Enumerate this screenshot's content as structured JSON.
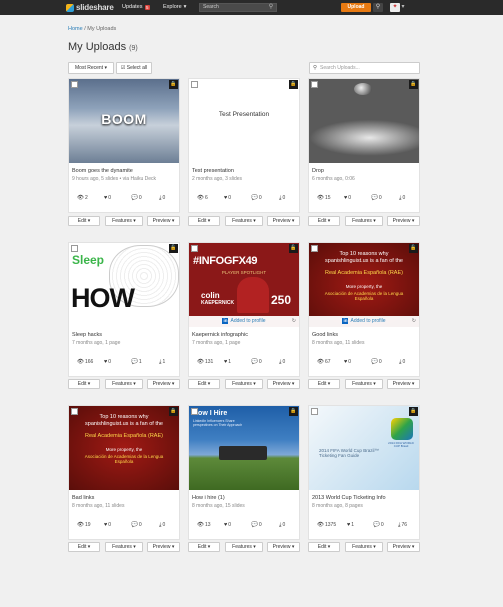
{
  "topbar": {
    "logo_text": "slideshare",
    "nav_updates": "Updates",
    "updates_count": "5",
    "nav_explore": "Explore",
    "search_placeholder": "Search",
    "upload_label": "Upload"
  },
  "breadcrumb": {
    "home": "Home",
    "sep": "/",
    "current": "My Uploads"
  },
  "page": {
    "title": "My Uploads",
    "count": "(9)"
  },
  "toolbar": {
    "sort_label": "Most Recent",
    "select_all": "Select all",
    "search_placeholder": "Search Uploads..."
  },
  "actions": {
    "edit": "Edit",
    "features": "Features",
    "preview": "Preview"
  },
  "linkedin": {
    "badge": "in",
    "text": "Added to profile"
  },
  "thumb_text": {
    "boom": "BOOM",
    "test": "Test Presentation",
    "sleep": "Sleep",
    "how": "HOW",
    "infogfx": "#INFOGFX49",
    "spotlight": "PLAYER SPOTLIGHT",
    "colin": "colin",
    "kaepernick": "KAEPERNICK",
    "num250": "250",
    "es_title": "Top 10 reasons why spanishlinguist.us is a fan of the",
    "es_rae": "Real Academia Española (RAE)",
    "es_more": "More property, the",
    "es_asoc": "Asociación de Academias de la Lengua Española",
    "hire": "How I Hire",
    "hire_sub": "LinkedIn Influencers Share perspectives on Their Approach",
    "wc_title": "2014 FIFA World Cup Brazil™ Ticketing Fan Guide",
    "wc_logo": "2014 FIFA WORLD CUP Brasil"
  },
  "cards": [
    {
      "title": "Boom goes the dynamite",
      "meta": "9 hours ago, 5 slides • via Haiku Deck",
      "views": "2",
      "likes": "0",
      "comments": "0",
      "downloads": "0"
    },
    {
      "title": "Test presentation",
      "meta": "2 months ago, 3 slides",
      "views": "6",
      "likes": "0",
      "comments": "0",
      "downloads": "0"
    },
    {
      "title": "Drop",
      "meta": "6 months ago, 0:06",
      "views": "15",
      "likes": "0",
      "comments": "0",
      "downloads": "0"
    },
    {
      "title": "Sleep hacks",
      "meta": "7 months ago, 1 page",
      "views": "166",
      "likes": "0",
      "comments": "1",
      "downloads": "1"
    },
    {
      "title": "Kaepernick infographic",
      "meta": "7 months ago, 1 page",
      "views": "131",
      "likes": "1",
      "comments": "0",
      "downloads": "0"
    },
    {
      "title": "Good links",
      "meta": "8 months ago, 11 slides",
      "views": "67",
      "likes": "0",
      "comments": "0",
      "downloads": "0"
    },
    {
      "title": "Bad links",
      "meta": "8 months ago, 11 slides",
      "views": "19",
      "likes": "0",
      "comments": "0",
      "downloads": "0"
    },
    {
      "title": "How i hire (1)",
      "meta": "8 months ago, 15 slides",
      "views": "13",
      "likes": "0",
      "comments": "0",
      "downloads": "0"
    },
    {
      "title": "2013 World Cup Ticketing Info",
      "meta": "8 months ago, 8 pages",
      "views": "1375",
      "likes": "1",
      "comments": "0",
      "downloads": "76"
    }
  ]
}
